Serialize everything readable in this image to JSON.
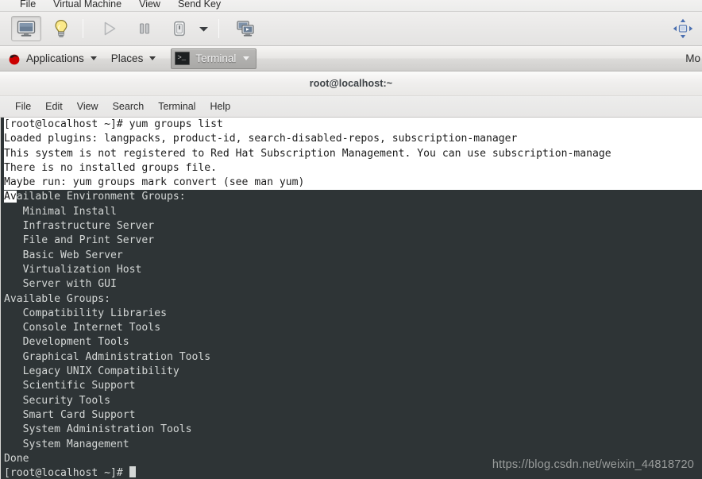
{
  "window": {
    "menubar": {
      "items": [
        {
          "label": "File",
          "name": "vm-menu-file"
        },
        {
          "label": "Virtual Machine",
          "name": "vm-menu-virtual-machine"
        },
        {
          "label": "View",
          "name": "vm-menu-view"
        },
        {
          "label": "Send Key",
          "name": "vm-menu-send-key"
        }
      ]
    },
    "toolbar": {
      "buttons": [
        {
          "name": "show-console-button",
          "icon": "monitor-icon",
          "state": "pressed"
        },
        {
          "name": "show-details-button",
          "icon": "lightbulb-icon",
          "state": "normal"
        },
        {
          "name": "run-button",
          "icon": "play-icon",
          "state": "disabled"
        },
        {
          "name": "pause-button",
          "icon": "pause-icon",
          "state": "normal"
        },
        {
          "name": "shutdown-button",
          "icon": "power-icon",
          "state": "normal"
        },
        {
          "name": "shutdown-menu-button",
          "icon": "chevron-down-icon",
          "state": "normal"
        },
        {
          "name": "snapshots-button",
          "icon": "snapshots-icon",
          "state": "normal"
        }
      ],
      "fullscreen_icon": "fullscreen-arrows-icon"
    }
  },
  "desktop_panel": {
    "logo_icon": "redhat-logo-icon",
    "applications_label": "Applications",
    "places_label": "Places",
    "task": {
      "icon": "terminal-icon",
      "icon_glyph": ">_",
      "label": "Terminal"
    },
    "clock": "Mo"
  },
  "terminal": {
    "title": "root@localhost:~",
    "menubar": [
      "File",
      "Edit",
      "View",
      "Search",
      "Terminal",
      "Help"
    ],
    "colors": {
      "background": "#2e3436",
      "foreground": "#d4d7d6",
      "selection_background": "#ffffff",
      "selection_foreground": "#1c1c1c"
    },
    "selected_lines": [
      "[root@localhost ~]# yum groups list",
      "Loaded plugins: langpacks, product-id, search-disabled-repos, subscription-manager",
      "This system is not registered to Red Hat Subscription Management. You can use subscription-manage",
      "There is no installed groups file.",
      "Maybe run: yum groups mark convert (see man yum)"
    ],
    "partial_selection": {
      "selected_text": "Av",
      "rest_text": "ailable Environment Groups:"
    },
    "lines": [
      "   Minimal Install",
      "   Infrastructure Server",
      "   File and Print Server",
      "   Basic Web Server",
      "   Virtualization Host",
      "   Server with GUI",
      "Available Groups:",
      "   Compatibility Libraries",
      "   Console Internet Tools",
      "   Development Tools",
      "   Graphical Administration Tools",
      "   Legacy UNIX Compatibility",
      "   Scientific Support",
      "   Security Tools",
      "   Smart Card Support",
      "   System Administration Tools",
      "   System Management",
      "Done"
    ],
    "prompt": "[root@localhost ~]# ",
    "watermark": "https://blog.csdn.net/weixin_44818720"
  }
}
